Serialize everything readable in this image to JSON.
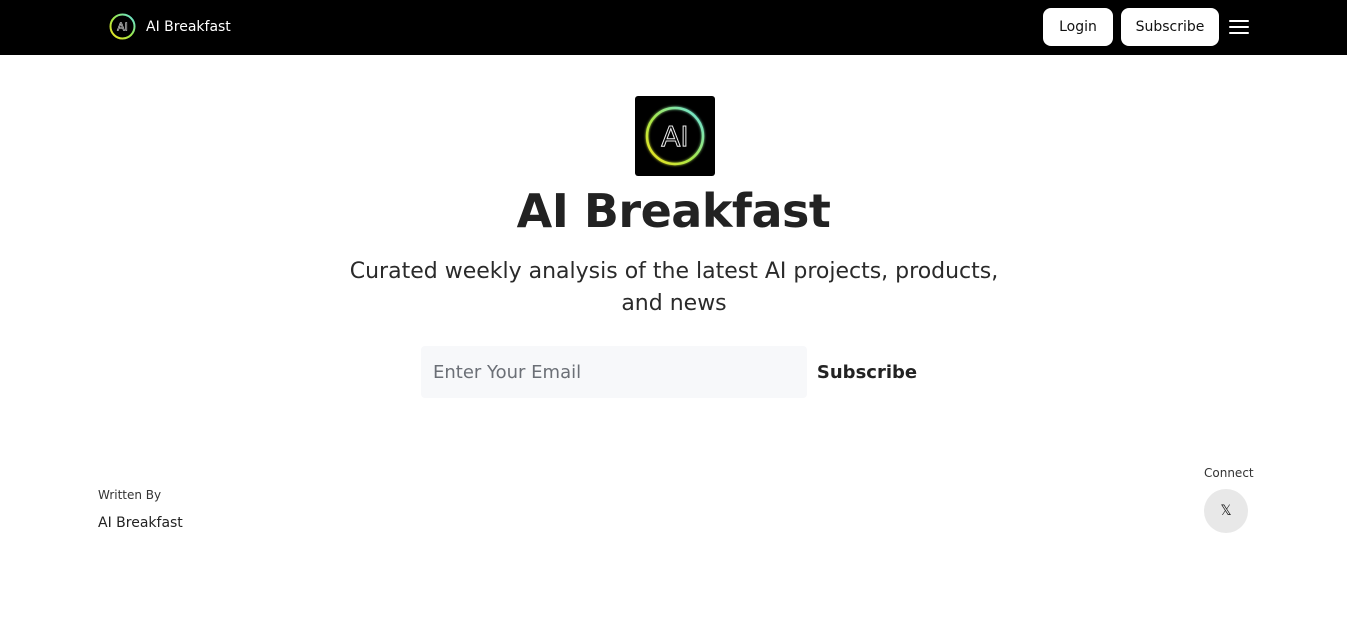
{
  "header": {
    "brand_name": "AI Breakfast",
    "logo_icon": "ai-logo-icon",
    "login_label": "Login",
    "subscribe_label": "Subscribe",
    "menu_icon": "hamburger-menu-icon"
  },
  "hero": {
    "logo_text": "AI",
    "title": "AI Breakfast",
    "description": "Curated weekly analysis of the latest AI projects, products, and news"
  },
  "signup": {
    "email_placeholder": "Enter Your Email",
    "subscribe_label": "Subscribe"
  },
  "footer": {
    "written_by_label": "Written By",
    "author": "AI Breakfast",
    "connect_label": "Connect",
    "x_icon_text": "𝕏"
  },
  "colors": {
    "header_bg": "#000000",
    "input_bg": "#f7f8fa",
    "logo_ring_start": "#c6f24a",
    "logo_ring_end": "#5fe0e6"
  }
}
